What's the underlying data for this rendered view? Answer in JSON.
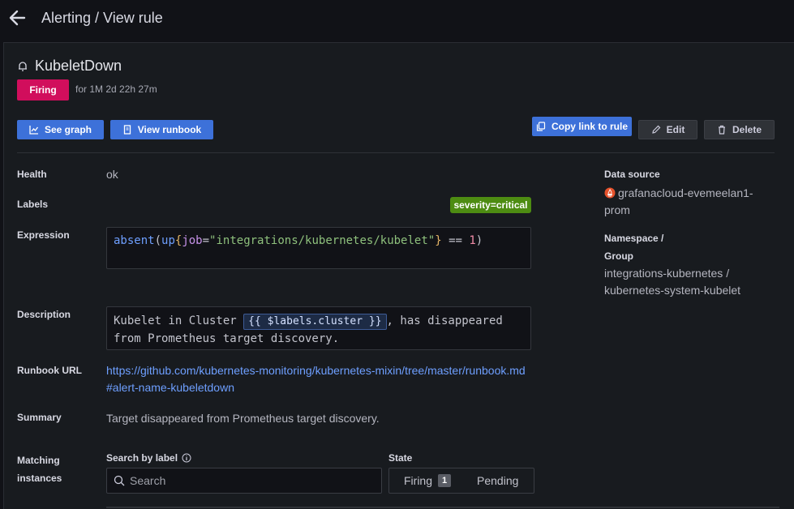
{
  "header": {
    "title": "Alerting / View rule"
  },
  "rule": {
    "name": "KubeletDown",
    "state": "Firing",
    "duration": "for 1M 2d 22h 27m"
  },
  "actions": {
    "see_graph": "See graph",
    "view_runbook": "View runbook",
    "copy_link": "Copy link to rule",
    "edit": "Edit",
    "delete": "Delete"
  },
  "details": {
    "health_label": "Health",
    "health_value": "ok",
    "labels_label": "Labels",
    "severity_badge": "severity=critical",
    "expression_label": "Expression",
    "expression": {
      "fn": "absent",
      "p1": "(",
      "inner_fn": "up",
      "lb": "{",
      "key": "job",
      "eq": "=",
      "str": "\"integrations/kubernetes/kubelet\"",
      "rb": "}",
      "op": " == ",
      "num": "1",
      "p2": ")"
    },
    "description_label": "Description",
    "description_pre": "Kubelet in Cluster ",
    "description_tmpl": "{{ $labels.cluster }}",
    "description_post": ", has disappeared from Prometheus target discovery.",
    "runbook_label": "Runbook URL",
    "runbook_url": "https://github.com/kubernetes-monitoring/kubernetes-mixin/tree/master/runbook.md#alert-name-kubeletdown",
    "summary_label": "Summary",
    "summary": "Target disappeared from Prometheus target discovery."
  },
  "sidebar": {
    "datasource_label": "Data source",
    "datasource_value": "grafanacloud-evemeelan1-prom",
    "namespace_label_1": "Namespace /",
    "namespace_label_2": "Group",
    "namespace_value": "integrations-kubernetes / kubernetes-system-kubelet"
  },
  "instances": {
    "label_1": "Matching",
    "label_2": "instances",
    "search_label": "Search by label",
    "search_placeholder": "Search",
    "state_label": "State",
    "firing": "Firing",
    "firing_count": "1",
    "pending": "Pending"
  },
  "colors": {
    "background": "#111217",
    "panel": "#181b1f",
    "accent": "#3d71d9",
    "firing": "#d10e5c",
    "severity": "#4d8c12"
  },
  "icons": [
    "arrow-left-icon",
    "bell-icon",
    "graph-icon",
    "book-icon",
    "copy-icon",
    "pencil-icon",
    "trash-icon",
    "prometheus-icon",
    "info-icon",
    "search-icon"
  ]
}
